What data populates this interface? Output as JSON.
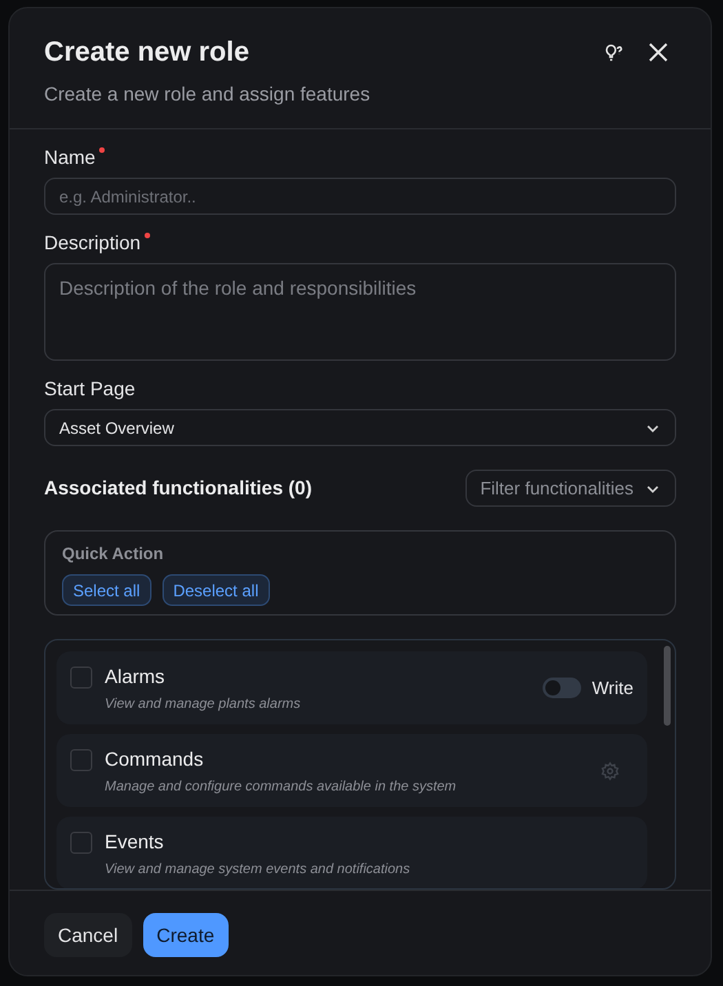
{
  "dialog": {
    "title": "Create new role",
    "subtitle": "Create a new role and assign features"
  },
  "fields": [
    {
      "kind": "input",
      "label": "Name",
      "required": true,
      "placeholder": "e.g. Administrator.."
    },
    {
      "kind": "textarea",
      "label": "Description",
      "required": true,
      "placeholder": "Description of the role and responsibilities"
    },
    {
      "kind": "select",
      "label": "Start Page",
      "required": false,
      "value": "Asset Overview"
    }
  ],
  "functionalities": {
    "title": "Associated functionalities (0)",
    "filter": {
      "placeholder": "Filter functionalities"
    },
    "quick_action": {
      "title": "Quick Action",
      "buttons": [
        "Select all",
        "Deselect all"
      ]
    },
    "items": [
      {
        "kind": "toggle",
        "name": "Alarms",
        "description": "View and manage plants alarms",
        "checked": false,
        "toggle": {
          "label": "Write",
          "on": false
        }
      },
      {
        "kind": "gear",
        "name": "Commands",
        "description": "Manage and configure commands available in the system",
        "checked": false
      },
      {
        "kind": "plain",
        "name": "Events",
        "description": "View and manage system events and notifications",
        "checked": false
      }
    ]
  },
  "buttons": [
    {
      "kind": "secondary",
      "label": "Cancel"
    },
    {
      "kind": "primary",
      "label": "Create"
    }
  ]
}
